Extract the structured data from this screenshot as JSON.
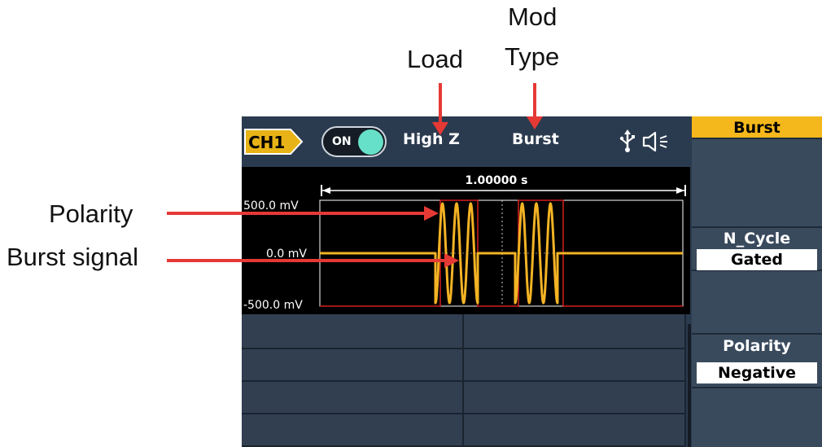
{
  "annotations": {
    "load_label": "Load",
    "mod_label_line1": "Mod",
    "mod_label_line2": "Type",
    "polarity_label": "Polarity",
    "burst_signal_label": "Burst signal"
  },
  "topbar": {
    "channel": "CH1",
    "output_toggle": "ON",
    "load": "High Z",
    "mode": "Burst",
    "usb_icon": "usb-icon",
    "speaker_icon": "speaker-icon"
  },
  "softkeys": {
    "title": "Burst",
    "mode_title": "N_Cycle",
    "mode_value": "Gated",
    "polarity_title": "Polarity",
    "polarity_value": "Negative"
  },
  "colors": {
    "panel": "#2b3b4f",
    "softkey_header": "#f5b81c",
    "waveform": "#f4b324",
    "gate": "#d21f1f",
    "toggle_on": "#66e0c8",
    "callout_arrow": "#e53935"
  },
  "chart_data": {
    "type": "line",
    "time_span_label": "1.00000 s",
    "yticks": [
      "500.0 mV",
      "0.0 mV",
      "-500.0 mV"
    ],
    "ylim": [
      -500,
      500
    ],
    "series": [
      {
        "signal": "burst",
        "cycles_per_burst": 3,
        "bursts": 2
      },
      {
        "signal": "gate"
      }
    ]
  }
}
